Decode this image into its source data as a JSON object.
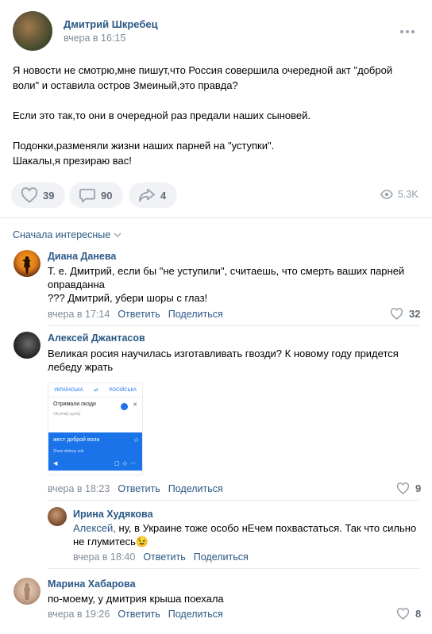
{
  "post": {
    "author": "Дмитрий Шкребец",
    "time": "вчера в 16:15",
    "text": "Я новости не смотрю,мне пишут,что Россия совершила очередной акт \"доброй воли\" и оставила остров Змеиный,это правда?\n\nЕсли это так,то они в очередной раз предали наших сыновей.\n\nПодонки,разменяли жизни наших парней на \"уступки\".\nШакалы,я презираю вас!",
    "likes": "39",
    "comments": "90",
    "shares": "4",
    "views": "5.3K"
  },
  "sort_label": "Сначала интересные",
  "comments": [
    {
      "author": "Диана Данева",
      "text": "Т. е. Дмитрий, если бы \"не уступили\", считаешь, что смерть ваших парней оправданна\n??? Дмитрий, убери шоры с глаз!",
      "time": "вчера в 17:14",
      "reply": "Ответить",
      "share": "Поделиться",
      "likes": "32"
    },
    {
      "author": "Алексей Джантасов",
      "text": "Великая росия научилась изготавливать гвозди? К новому году придется лебеду жрать",
      "time": "вчера в 18:23",
      "reply": "Ответить",
      "share": "Поделиться",
      "likes": "9",
      "screenshot": {
        "lang_from": "УКРАЇНСЬКА",
        "lang_to": "РОСІЙСЬКА",
        "source": "Отримали пизди",
        "source_translit": "Otrymaly pyzdy",
        "result": "жест доброй воли",
        "result_translit": "Zhest dobroy voli"
      }
    },
    {
      "author": "Ирина Худякова",
      "reply_to": "Алексей,",
      "text": " ну, в Украине тоже особо нЕчем похвастаться. Так что сильно не глумитесь😉",
      "time": "вчера в 18:40",
      "reply": "Ответить",
      "share": "Поделиться"
    },
    {
      "author": "Марина Хабарова",
      "text": "по-моему, у дмитрия крыша поехала",
      "time": "вчера в 19:26",
      "reply": "Ответить",
      "share": "Поделиться",
      "likes": "8"
    }
  ],
  "colors": {
    "link": "#2a5885",
    "meta": "#818c99",
    "button_bg": "#f0f2f5",
    "translate_blue": "#1a73e8"
  }
}
